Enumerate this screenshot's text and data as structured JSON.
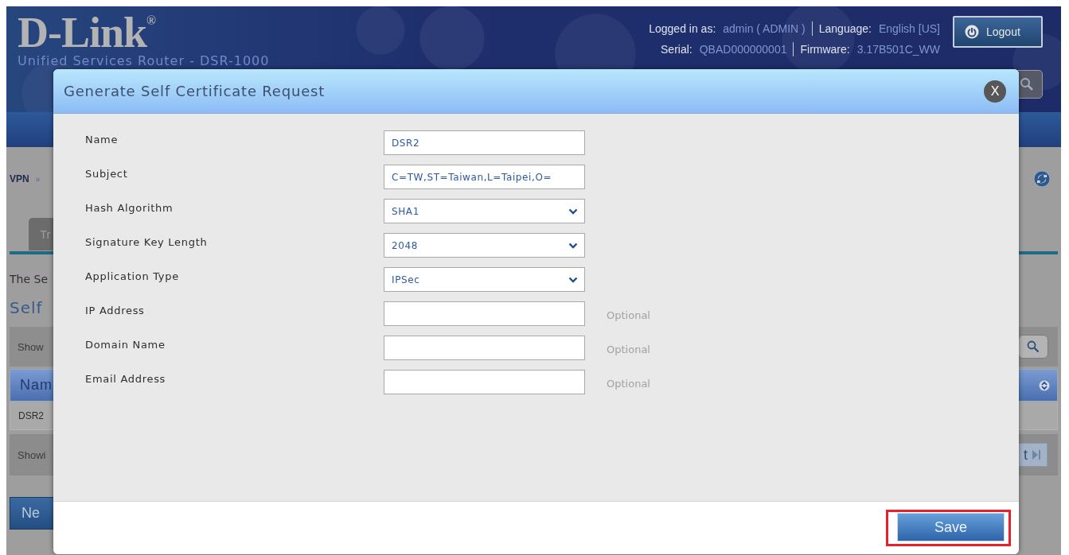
{
  "header": {
    "logo": "D-Link$^{®}$",
    "subtitle": "Unified Services Router - DSR-1000",
    "account": [
      {
        "label": "Logged in as:",
        "value": "admin ( ADMIN )"
      },
      {
        "label": "Language:",
        "value": "English [US]"
      }
    ],
    "device": [
      {
        "label": "Serial:",
        "value": "QBAD000000001"
      },
      {
        "label": "Firmware:",
        "value": "3.17B501C_WW"
      }
    ],
    "logout": "Logout"
  },
  "page": {
    "breadcrumb": "VPN",
    "breadcrumb_separator": "»",
    "tabs": [
      {
        "label": "Tr",
        "selected": true
      }
    ],
    "intro": "The Se",
    "section_title": "Self",
    "toolbar_text": "Show",
    "table": {
      "columns": [
        "Nam"
      ],
      "rows": [
        [
          "DSR2"
        ]
      ]
    },
    "footer_text": "Showi",
    "pager_text": "t",
    "new_button": "Ne"
  },
  "dialog": {
    "title": "Generate Self Certificate Request",
    "close": "X",
    "fields": [
      {
        "label": "Name",
        "kind": "text",
        "value": "DSR2"
      },
      {
        "label": "Subject",
        "kind": "text",
        "value": "C=TW,ST=Taiwan,L=Taipei,O="
      },
      {
        "label": "Hash Algorithm",
        "kind": "select",
        "value": "SHA1"
      },
      {
        "label": "Signature Key Length",
        "kind": "select",
        "value": "2048"
      },
      {
        "label": "Application Type",
        "kind": "select",
        "value": "IPSec"
      },
      {
        "label": "IP Address",
        "kind": "text",
        "note": "Optional"
      },
      {
        "label": "Domain Name",
        "kind": "text",
        "note": "Optional"
      },
      {
        "label": "Email Address",
        "kind": "text",
        "note": "Optional"
      }
    ],
    "save_button": {
      "label": "Save",
      "highlighted": true
    }
  }
}
